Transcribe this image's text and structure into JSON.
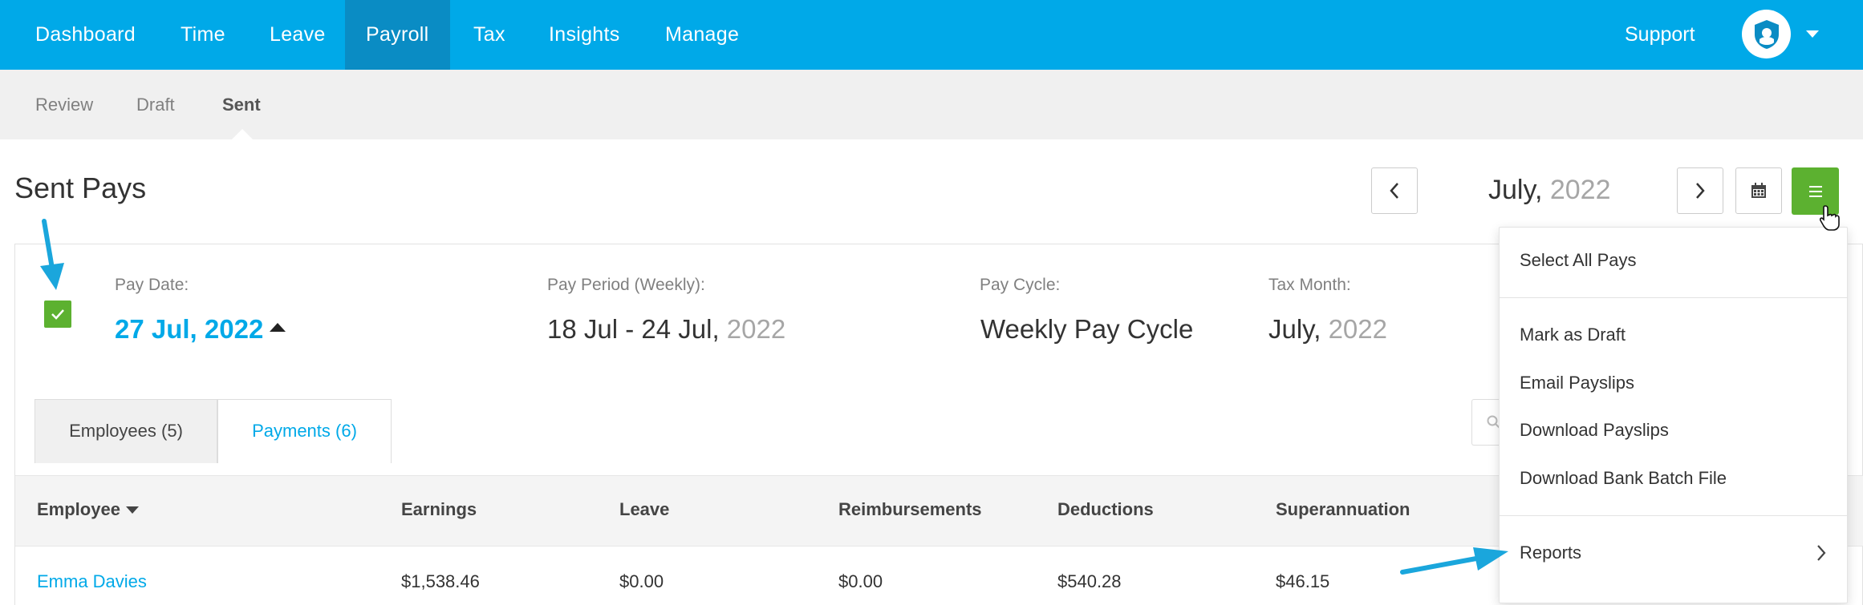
{
  "nav": {
    "items": [
      "Dashboard",
      "Time",
      "Leave",
      "Payroll",
      "Tax",
      "Insights",
      "Manage"
    ],
    "active": "Payroll",
    "support_label": "Support"
  },
  "subnav": {
    "items": [
      "Review",
      "Draft",
      "Sent"
    ],
    "active": "Sent"
  },
  "page": {
    "title": "Sent Pays",
    "month": "July,",
    "year": "2022"
  },
  "pay": {
    "pay_date_label": "Pay Date:",
    "pay_date_value": "27 Jul, 2022",
    "pay_period_label": "Pay Period (Weekly):",
    "pay_period_value": "18 Jul - 24 Jul,",
    "pay_period_year": "2022",
    "pay_cycle_label": "Pay Cycle:",
    "pay_cycle_value": "Weekly Pay Cycle",
    "tax_month_label": "Tax Month:",
    "tax_month_value": "July,",
    "tax_month_year": "2022",
    "selected": true
  },
  "tabs": {
    "employees": "Employees (5)",
    "payments": "Payments (6)"
  },
  "table": {
    "columns": [
      "Employee",
      "Earnings",
      "Leave",
      "Reimbursements",
      "Deductions",
      "Superannuation"
    ],
    "rows": [
      {
        "employee": "Emma Davies",
        "earnings": "$1,538.46",
        "leave": "$0.00",
        "reimbursements": "$0.00",
        "deductions": "$540.28",
        "superannuation": "$46.15"
      }
    ]
  },
  "menu": {
    "select_all": "Select All Pays",
    "mark_draft": "Mark as Draft",
    "email_payslips": "Email Payslips",
    "download_payslips": "Download Payslips",
    "download_bank": "Download Bank Batch File",
    "reports": "Reports"
  },
  "colors": {
    "brand_blue": "#00a9e8",
    "active_nav": "#0a8cc4",
    "action_green": "#5cb130"
  }
}
